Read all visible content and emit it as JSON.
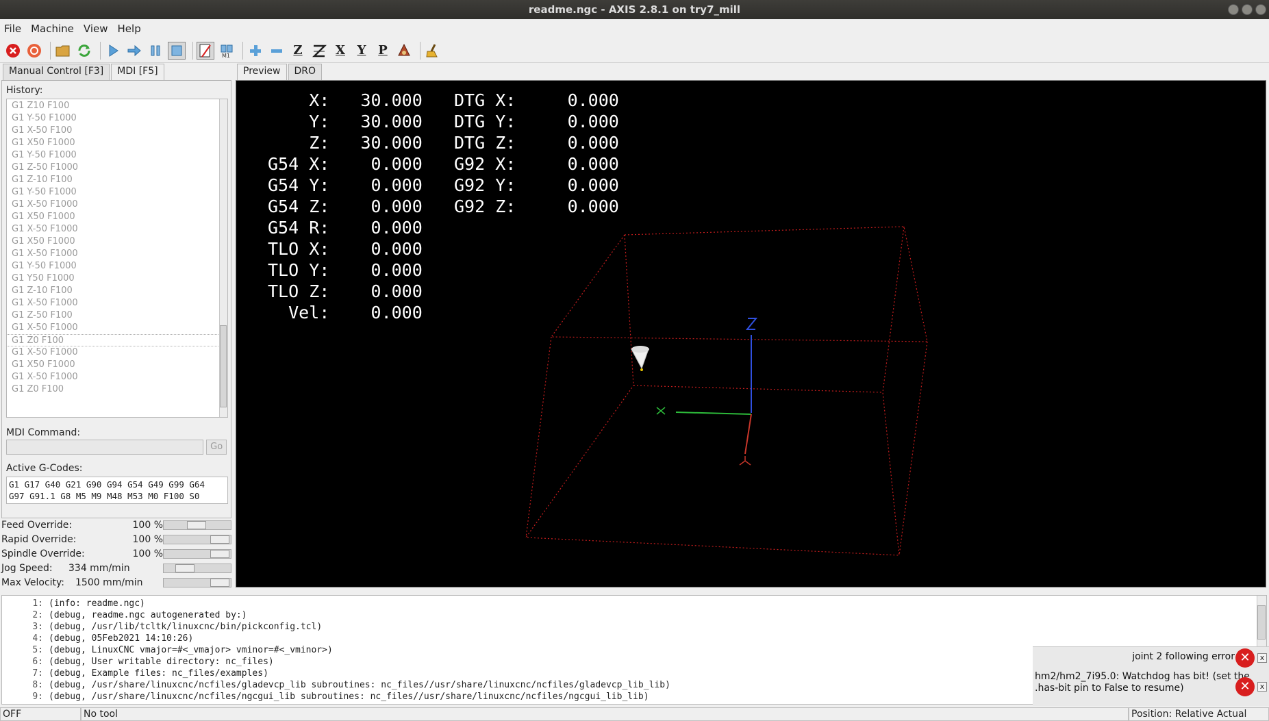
{
  "window": {
    "title": "readme.ngc - AXIS 2.8.1 on try7_mill"
  },
  "menu": [
    "File",
    "Machine",
    "View",
    "Help"
  ],
  "toolbar": {
    "estop_icon": "estop-icon",
    "power_icon": "power-icon",
    "axis_labels": [
      "Z",
      "X",
      "Y",
      "P"
    ]
  },
  "left_tabs": [
    "Manual Control [F3]",
    "MDI [F5]"
  ],
  "mdi": {
    "history_label": "History:",
    "history": [
      "G1 Z10 F100",
      "G1 Y-50 F1000",
      "G1 X-50 F100",
      "G1 X50 F1000",
      "G1 Y-50 F1000",
      "G1 Z-50 F1000",
      "G1 Z-10 F100",
      "G1 Y-50 F1000",
      "G1 X-50 F1000",
      "G1 X50 F1000",
      "G1 X-50 F1000",
      "G1 X50 F1000",
      "G1 X-50 F1000",
      "G1 Y-50 F1000",
      "G1 Y50 F1000",
      "G1 Z-10 F100",
      "G1 X-50 F1000",
      "G1 Z-50 F100",
      "G1 X-50 F1000",
      "G1 Z0 F100",
      "G1 X-50 F1000",
      "G1 X50 F1000",
      "G1 X-50 F1000",
      "G1 Z0 F100"
    ],
    "command_label": "MDI Command:",
    "command_value": "",
    "go_label": "Go",
    "active_label": "Active G-Codes:",
    "active_codes": "G1 G17 G40 G21 G90 G94 G54 G49 G99 G64\nG97 G91.1 G8 M5 M9 M48 M53 M0 F100 S0"
  },
  "overrides": {
    "feed": {
      "label": "Feed Override:",
      "value": "100 %",
      "level": 0.5
    },
    "rapid": {
      "label": "Rapid Override:",
      "value": "100 %",
      "level": 1.0
    },
    "spindle": {
      "label": "Spindle Override:",
      "value": "100 %",
      "level": 1.0
    },
    "jog": {
      "label": "Jog Speed:",
      "value": "334 mm/min",
      "level": 0.25
    },
    "maxvel": {
      "label": "Max Velocity:",
      "value": "1500 mm/min",
      "level": 1.0
    }
  },
  "preview_tabs": [
    "Preview",
    "DRO"
  ],
  "dro": {
    "left": "    X:   30.000\n    Y:   30.000\n    Z:   30.000\nG54 X:    0.000\nG54 Y:    0.000\nG54 Z:    0.000\nG54 R:    0.000\nTLO X:    0.000\nTLO Y:    0.000\nTLO Z:    0.000\n  Vel:    0.000",
    "right": "DTG X:     0.000\nDTG Y:     0.000\nDTG Z:     0.000\nG92 X:     0.000\nG92 Y:     0.000\nG92 Z:     0.000"
  },
  "console": [
    {
      "n": "1:",
      "t": "(info: readme.ngc)"
    },
    {
      "n": "2:",
      "t": "(debug, readme.ngc autogenerated by:)"
    },
    {
      "n": "3:",
      "t": "(debug, /usr/lib/tcltk/linuxcnc/bin/pickconfig.tcl)"
    },
    {
      "n": "4:",
      "t": "(debug, 05Feb2021 14:10:26)"
    },
    {
      "n": "5:",
      "t": "(debug, LinuxCNC vmajor=#<_vmajor> vminor=#<_vminor>)"
    },
    {
      "n": "6:",
      "t": "(debug, User writable directory: nc_files)"
    },
    {
      "n": "7:",
      "t": "(debug, Example files: nc_files/examples)"
    },
    {
      "n": "8:",
      "t": "(debug, /usr/share/linuxcnc/ncfiles/gladevcp_lib subroutines: nc_files//usr/share/linuxcnc/ncfiles/gladevcp_lib_lib)"
    },
    {
      "n": "9:",
      "t": "(debug, /usr/share/linuxcnc/ncfiles/ngcgui_lib subroutines: nc_files//usr/share/linuxcnc/ncfiles/ngcgui_lib_lib)"
    }
  ],
  "errors": {
    "first": "joint 2 following error",
    "second_line1": "hm2/hm2_7i95.0: Watchdog has bit! (set the",
    "second_line2": ".has-bit pin to False to resume)",
    "close": "x"
  },
  "statusbar": {
    "state": "OFF",
    "tool": "No tool",
    "position": "Position: Relative Actual"
  },
  "colors": {
    "estop": "#d81e1e",
    "x_axis": "#c8362a",
    "y_axis": "#2dbb3a",
    "z_axis": "#3050e0",
    "limits": "#c41d1d"
  }
}
